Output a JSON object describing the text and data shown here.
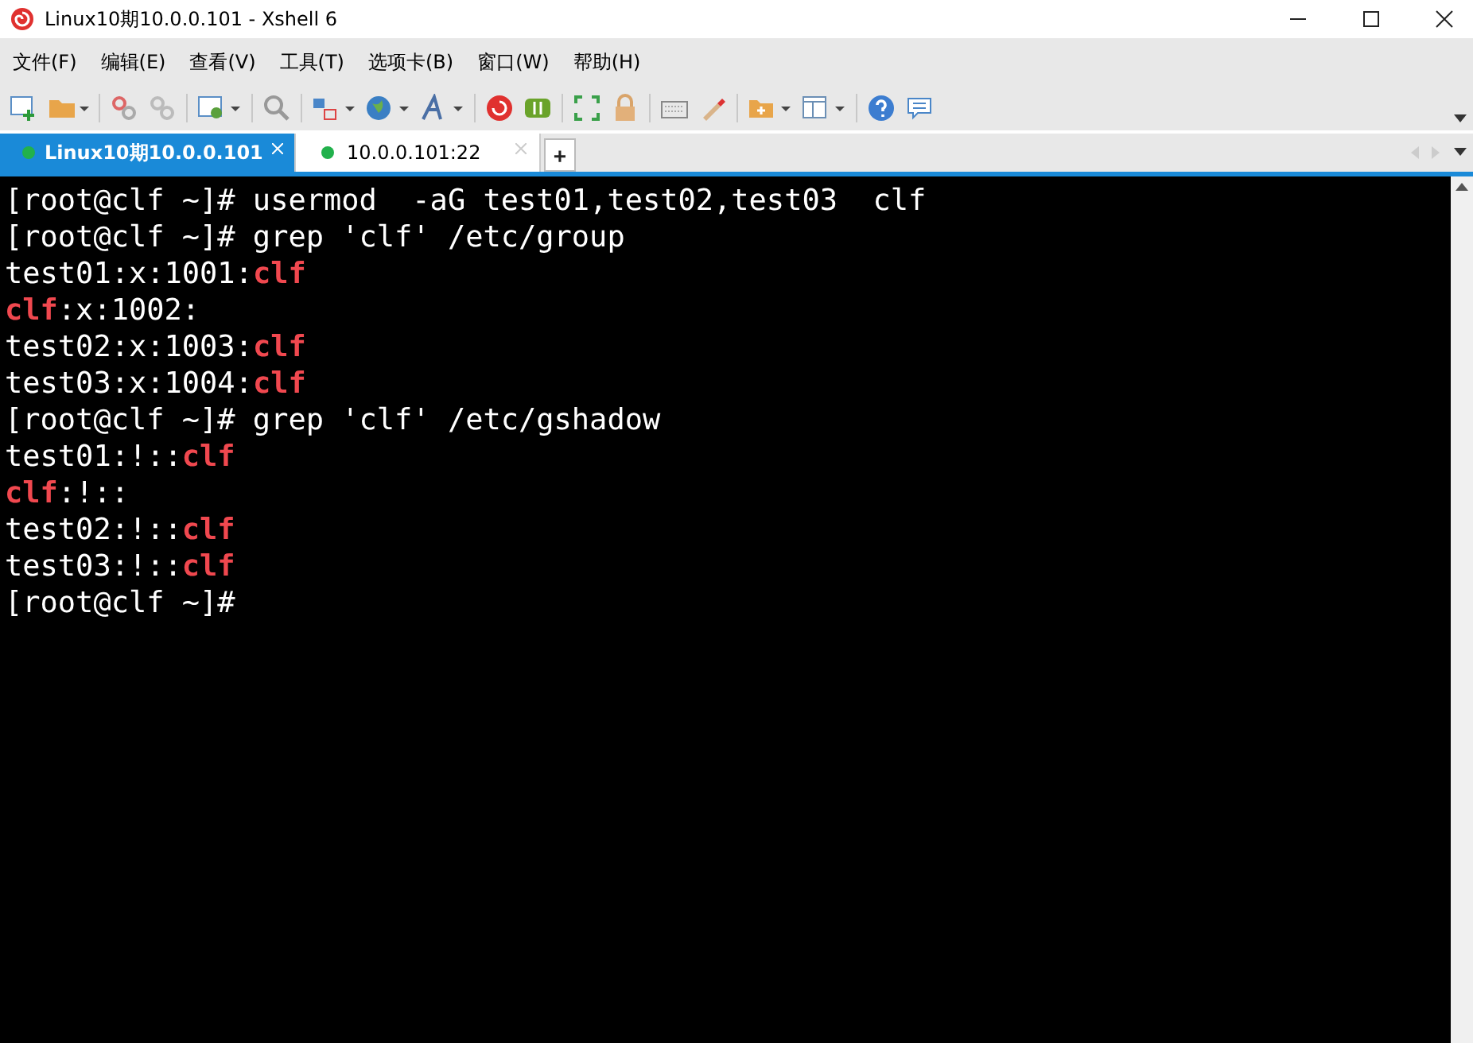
{
  "window": {
    "title": "Linux10期10.0.0.101 - Xshell 6"
  },
  "menu": [
    "文件(F)",
    "编辑(E)",
    "查看(V)",
    "工具(T)",
    "选项卡(B)",
    "窗口(W)",
    "帮助(H)"
  ],
  "tabs": [
    {
      "label": "Linux10期10.0.0.101",
      "selected": true,
      "connected": true
    },
    {
      "label": "10.0.0.101:22",
      "selected": false,
      "connected": true
    }
  ],
  "new_tab": "+",
  "terminal": {
    "lines": [
      [
        {
          "text": "[root@clf ~]# usermod  -aG test01,test02,test03  clf",
          "match": false
        }
      ],
      [
        {
          "text": "[root@clf ~]# grep 'clf' /etc/group",
          "match": false
        }
      ],
      [
        {
          "text": "test01:x:1001:",
          "match": false
        },
        {
          "text": "clf",
          "match": true
        }
      ],
      [
        {
          "text": "clf",
          "match": true
        },
        {
          "text": ":x:1002:",
          "match": false
        }
      ],
      [
        {
          "text": "test02:x:1003:",
          "match": false
        },
        {
          "text": "clf",
          "match": true
        }
      ],
      [
        {
          "text": "test03:x:1004:",
          "match": false
        },
        {
          "text": "clf",
          "match": true
        }
      ],
      [
        {
          "text": "[root@clf ~]# grep 'clf' /etc/gshadow",
          "match": false
        }
      ],
      [
        {
          "text": "test01:!::",
          "match": false
        },
        {
          "text": "clf",
          "match": true
        }
      ],
      [
        {
          "text": "clf",
          "match": true
        },
        {
          "text": ":!::",
          "match": false
        }
      ],
      [
        {
          "text": "test02:!::",
          "match": false
        },
        {
          "text": "clf",
          "match": true
        }
      ],
      [
        {
          "text": "test03:!::",
          "match": false
        },
        {
          "text": "clf",
          "match": true
        }
      ],
      [
        {
          "text": "[root@clf ~]#",
          "match": false
        }
      ]
    ]
  }
}
